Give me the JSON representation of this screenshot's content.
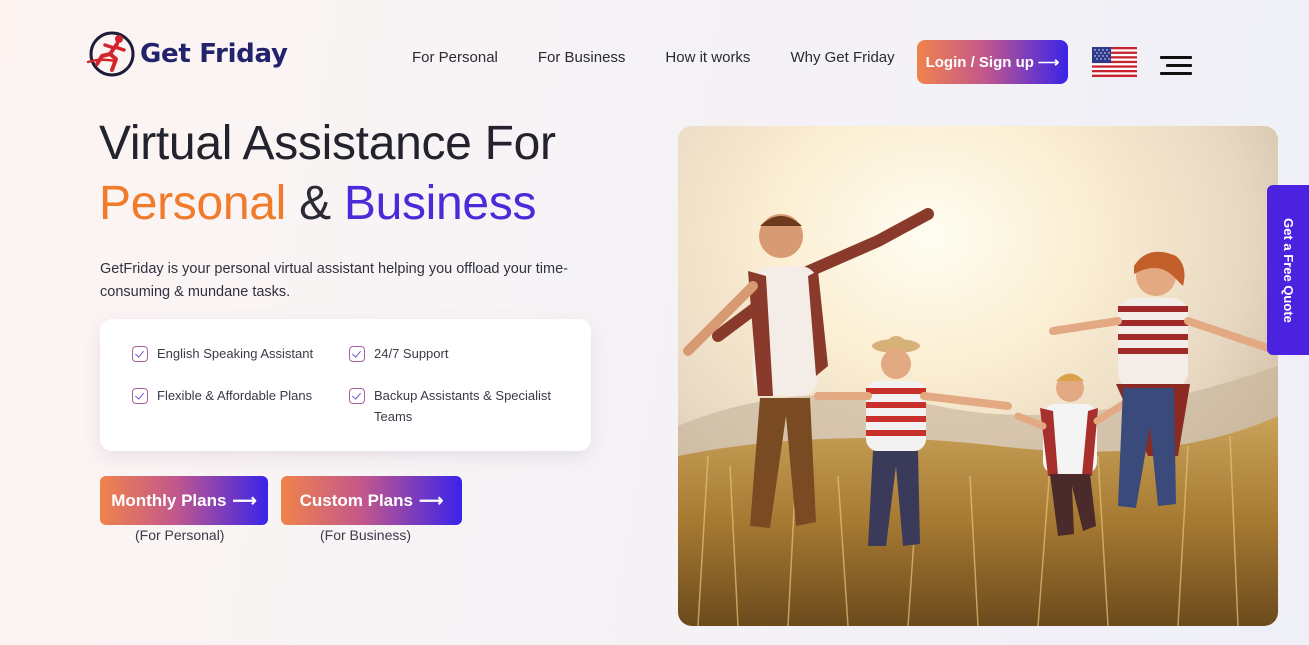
{
  "brand": {
    "name": "Get Friday"
  },
  "nav": [
    {
      "label": "For Personal"
    },
    {
      "label": "For Business"
    },
    {
      "label": "How it works"
    },
    {
      "label": "Why Get Friday"
    }
  ],
  "login_button": {
    "label": "Login / Sign up",
    "arrow": "⟶"
  },
  "language": {
    "icon": "us-flag-icon"
  },
  "menu": {
    "icon": "hamburger-menu-icon"
  },
  "hero": {
    "title_line1": "Virtual Assistance For",
    "title_personal": "Personal",
    "title_amp": "&",
    "title_business": "Business",
    "description": "GetFriday is your personal virtual assistant helping you offload your time-consuming & mundane tasks.",
    "features": [
      {
        "label": "English Speaking Assistant"
      },
      {
        "label": "24/7 Support"
      },
      {
        "label": "Flexible & Affordable Plans"
      },
      {
        "label": "Backup Assistants & Specialist Teams"
      }
    ],
    "buttons": [
      {
        "label": "Monthly Plans",
        "sub": "(For Personal)"
      },
      {
        "label": "Custom Plans",
        "sub": "(For Business)"
      }
    ]
  },
  "side_tab": {
    "label": "Get a Free Quote"
  },
  "colors": {
    "orange": "#f07b2b",
    "purple": "#4a2bd8",
    "navy": "#23236b",
    "tab": "#4b22e0"
  }
}
